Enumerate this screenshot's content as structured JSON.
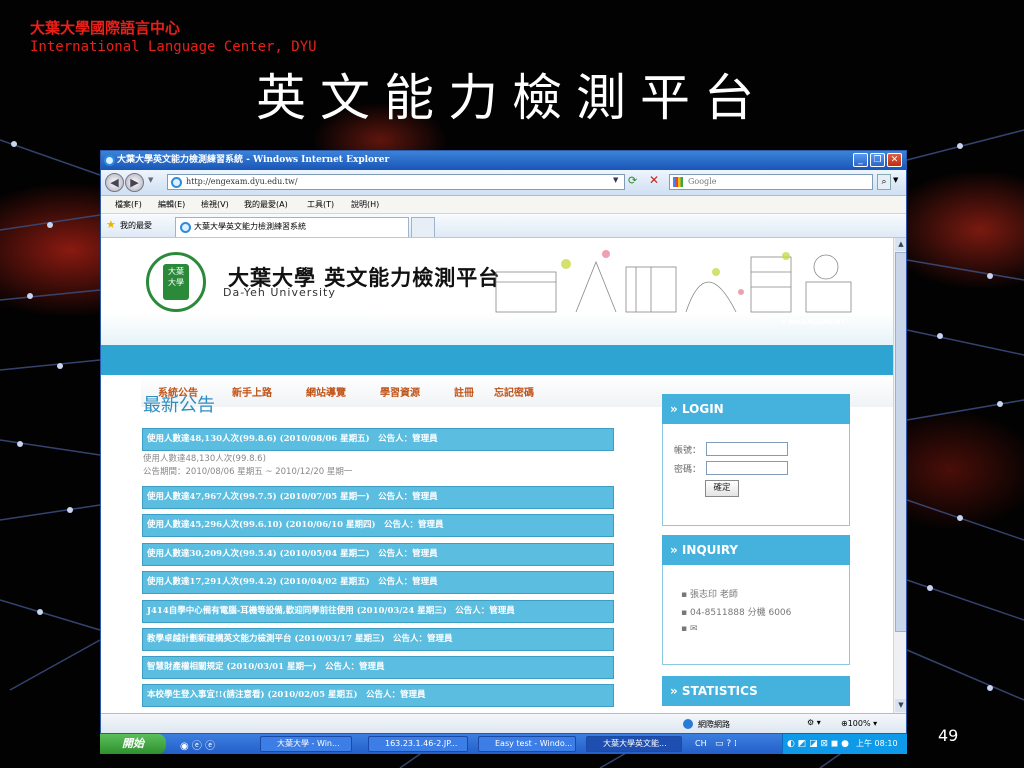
{
  "slide": {
    "org_zh": "大葉大學國際語言中心",
    "org_en": "International Language Center, DYU",
    "title": "英文能力檢測平台",
    "page_number": "49"
  },
  "browser": {
    "title": "大葉大學英文能力檢測練習系統 - Windows Internet Explorer",
    "address": "http://engexam.dyu.edu.tw/",
    "search_placeholder": "Google",
    "menu": [
      "檔案(F)",
      "編輯(E)",
      "檢視(V)",
      "我的最愛(A)",
      "工具(T)",
      "說明(H)"
    ],
    "favorites_label": "我的最愛",
    "tab_label": "大葉大學英文能力檢測練習系統",
    "status_zone": "網際網路",
    "zoom": "100%"
  },
  "site": {
    "name": "大葉大學 英文能力檢測平台",
    "name_en": "Da-Yeh University",
    "management": "MANAGEMENT",
    "nav": [
      "系統公告",
      "新手上路",
      "網站導覽",
      "學習資源",
      "註冊",
      "忘記密碼"
    ],
    "news_title": "最新公告",
    "news": [
      "使用人數達48,130人次(99.8.6) (2010/08/06 星期五)　公告人：管理員",
      "使用人數達47,967人次(99.7.5) (2010/07/05 星期一)　公告人：管理員",
      "使用人數達45,296人次(99.6.10) (2010/06/10 星期四)　公告人：管理員",
      "使用人數達30,209人次(99.5.4) (2010/05/04 星期二)　公告人：管理員",
      "使用人數達17,291人次(99.4.2) (2010/04/02 星期五)　公告人：管理員",
      "J414自學中心備有電腦-耳機等設備,歡迎同學前往使用 (2010/03/24 星期三)　公告人：管理員",
      "教學卓越計劃新建構英文能力檢測平台 (2010/03/17 星期三)　公告人：管理員",
      "智慧財產權相關規定 (2010/03/01 星期一)　公告人：管理員",
      "本校學生登入事宜!!(請注意看) (2010/02/05 星期五)　公告人：管理員"
    ],
    "news_detail_1": "使用人數達48,130人次(99.8.6)",
    "news_detail_2": "公告期間：2010/08/06 星期五 ~ 2010/12/20 星期一",
    "login": {
      "header": "» LOGIN",
      "account_label": "帳號：",
      "password_label": "密碼：",
      "submit": "確定"
    },
    "inquiry": {
      "header": "» INQUIRY",
      "items": [
        "張志印 老師",
        "04-8511888 分機 6006",
        "✉"
      ]
    },
    "statistics_header": "» STATISTICS"
  },
  "taskbar": {
    "start": "開始",
    "tasks": [
      "大葉大學 - Win...",
      "163.23.1.46-2.JP...",
      "Easy test - Windo...",
      "大葉大學英文能..."
    ],
    "lang": "CH",
    "clock": "上午 08:10"
  }
}
